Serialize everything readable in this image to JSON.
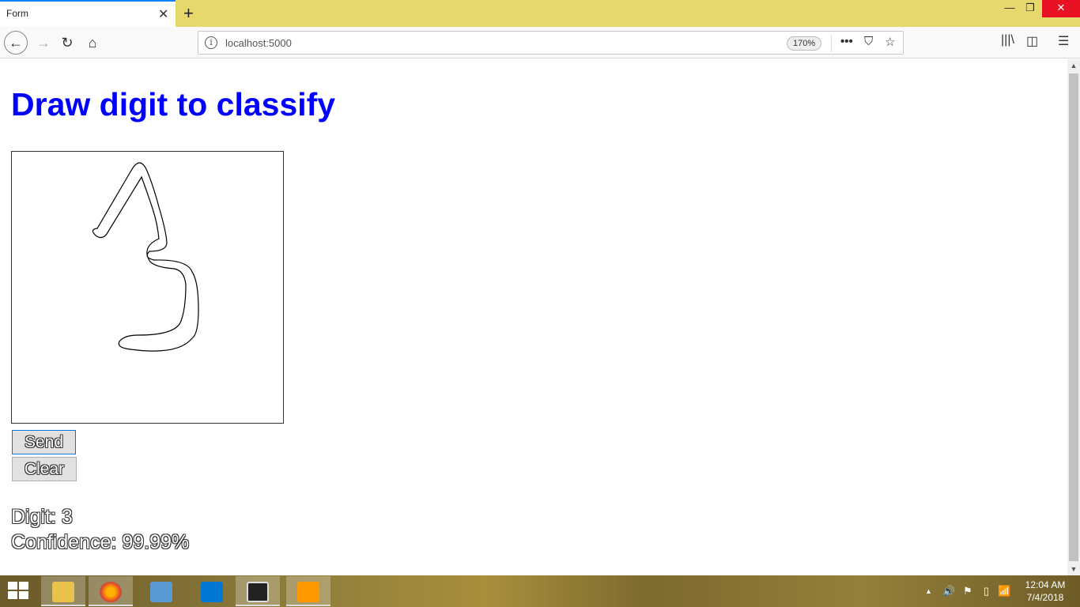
{
  "browser": {
    "tab_title": "Form",
    "tab_close": "✕",
    "new_tab": "+",
    "window_controls": {
      "minimize": "—",
      "maximize": "❐",
      "close": "✕"
    },
    "nav": {
      "back": "←",
      "forward": "→",
      "reload": "↻",
      "home": "⌂"
    },
    "url": "localhost:5000",
    "info_icon": "i",
    "zoom": "170%",
    "url_actions": {
      "more": "•••",
      "pocket": "⛉",
      "star": "☆"
    },
    "toolbar_right": {
      "library": "|||\\",
      "sidebar": "◫",
      "menu": "☰"
    }
  },
  "page": {
    "heading": "Draw digit to classify",
    "send_label": "Send",
    "clear_label": "Clear",
    "digit_text": "Digit: 3",
    "confidence_text": "Confidence: 99.99%"
  },
  "scrollbar": {
    "up": "▲",
    "down": "▼"
  },
  "taskbar": {
    "tray": {
      "chevron": "▲",
      "volume": "🔊",
      "flag": "⚑",
      "battery": "▯",
      "signal": "📶"
    },
    "time": "12:04 AM",
    "date": "7/4/2018"
  }
}
